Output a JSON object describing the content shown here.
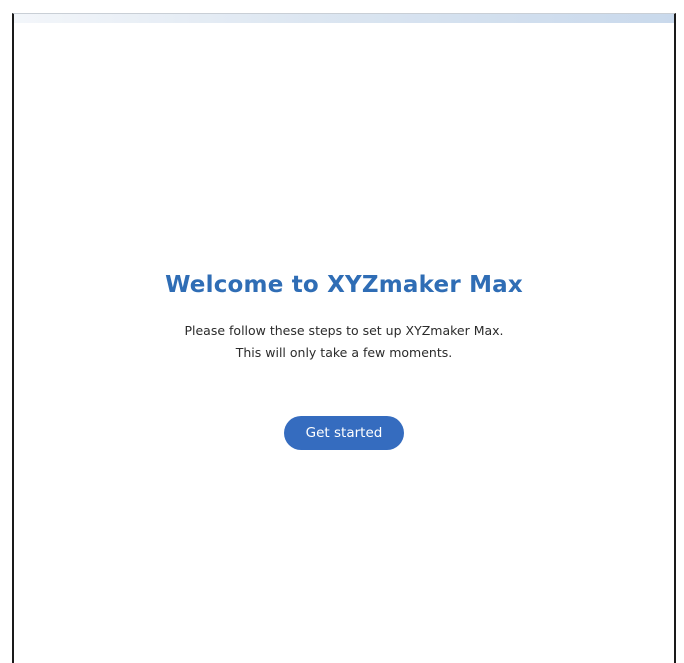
{
  "welcome": {
    "title": "Welcome to XYZmaker Max",
    "instruction_line1": "Please follow these steps to set up XYZmaker Max.",
    "instruction_line2": "This will only take a few moments.",
    "get_started_label": "Get started"
  },
  "colors": {
    "accent": "#356cbf",
    "title": "#2f6db5",
    "text": "#2b2b2b"
  }
}
